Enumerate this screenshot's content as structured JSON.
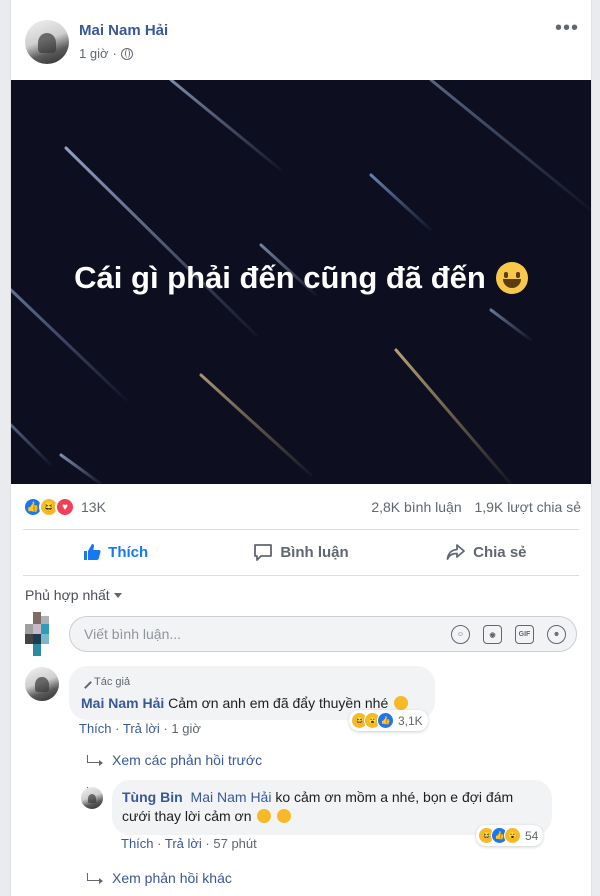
{
  "post": {
    "author": "Mai Nam Hải",
    "time": "1 giờ",
    "more_icon": "•••",
    "banner_text": "Cái gì phải đến cũng đã đến",
    "banner_emoji": "grinning-face-emoji",
    "banner_color": "#0d0e1f"
  },
  "stats": {
    "reaction_icons": [
      "like",
      "haha",
      "love"
    ],
    "reaction_count": "13K",
    "comments": "2,8K bình luận",
    "shares": "1,9K lượt chia sẻ"
  },
  "actions": {
    "like": "Thích",
    "comment": "Bình luận",
    "share": "Chia sẻ",
    "liked_color": "#1877f2"
  },
  "comments_section": {
    "sort_label": "Phủ hợp nhất",
    "input_placeholder": "Viết bình luận...",
    "input_icons": [
      "emoji-icon",
      "camera-icon",
      "gif-icon",
      "sticker-icon"
    ],
    "gif_label": "GIF"
  },
  "comment1": {
    "author_tag": "Tác giả",
    "author": "Mai Nam Hải",
    "text": "Cảm ơn anh em đã đẩy thuyền nhé",
    "like": "Thích",
    "reply": "Trả lời",
    "time": "1 giờ",
    "reactions_count": "3,1K"
  },
  "view_previous": "Xem các phản hồi trước",
  "reply1": {
    "author": "Tùng Bin",
    "mention": "Mai Nam Hải",
    "text_line1": "ko cảm ơn mồm a nhé, bọn e đợi đám",
    "text_line2": "cưới thay lời cảm ơn",
    "like": "Thích",
    "reply": "Trả lời",
    "time": "57 phút",
    "reactions_count": "54"
  },
  "view_more": "Xem phản hồi khác"
}
